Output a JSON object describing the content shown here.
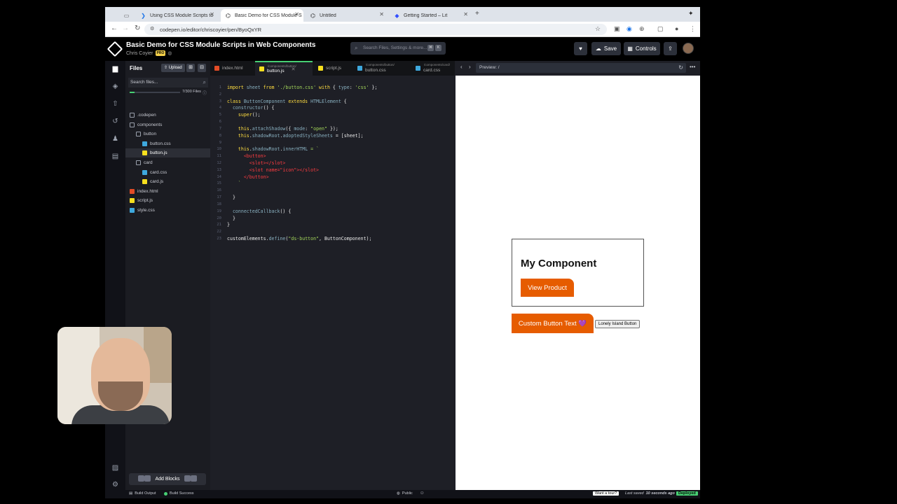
{
  "browser": {
    "tabs": [
      {
        "title": "Using CSS Module Scripts to",
        "active": false
      },
      {
        "title": "Basic Demo for CSS Module S",
        "active": true
      },
      {
        "title": "Untitled",
        "active": false
      },
      {
        "title": "Getting Started – Lit",
        "active": false
      }
    ],
    "new_tab": "+",
    "url": "codepen.io/editor/chriscoyier/pen/ByoQxYR"
  },
  "header": {
    "title": "Basic Demo for CSS Module Scripts in Web Components",
    "author": "Chris Coyier",
    "pro_badge": "PRO",
    "search_placeholder": "Search Files, Settings & more...",
    "kbd1": "⌘",
    "kbd2": "K",
    "save_label": "Save",
    "controls_label": "Controls"
  },
  "files_panel": {
    "title": "Files",
    "upload_label": "Upload",
    "search_placeholder": "Search files...",
    "quota_text": "7/300 Files",
    "quota_fraction": 0.023,
    "tree": [
      {
        "label": ".codepen",
        "icon": "folder-icon",
        "indent": 0,
        "color": "#9aa0ac"
      },
      {
        "label": "components",
        "icon": "folder-icon",
        "indent": 0,
        "color": "#9aa0ac"
      },
      {
        "label": "button",
        "icon": "folder-icon",
        "indent": 1,
        "color": "#9aa0ac"
      },
      {
        "label": "button.css",
        "icon": "css-file-icon",
        "indent": 2,
        "color": "#3ea8dd"
      },
      {
        "label": "button.js",
        "icon": "js-file-icon",
        "indent": 2,
        "color": "#f7df1e",
        "selected": true
      },
      {
        "label": "card",
        "icon": "folder-icon",
        "indent": 1,
        "color": "#9aa0ac"
      },
      {
        "label": "card.css",
        "icon": "css-file-icon",
        "indent": 2,
        "color": "#3ea8dd"
      },
      {
        "label": "card.js",
        "icon": "js-file-icon",
        "indent": 2,
        "color": "#f7df1e"
      },
      {
        "label": "index.html",
        "icon": "html-file-icon",
        "indent": 0,
        "color": "#e34c26"
      },
      {
        "label": "script.js",
        "icon": "js-file-icon",
        "indent": 0,
        "color": "#f7df1e"
      },
      {
        "label": "style.css",
        "icon": "css-file-icon",
        "indent": 0,
        "color": "#3ea8dd"
      }
    ],
    "add_blocks_label": "Add Blocks"
  },
  "editor_tabs": [
    {
      "label": "index.html",
      "sub": "",
      "color": "#e34c26",
      "active": false
    },
    {
      "label": "button.js",
      "sub": "/components/button/",
      "color": "#f7df1e",
      "active": true
    },
    {
      "label": "script.js",
      "sub": "",
      "color": "#f7df1e",
      "active": false
    },
    {
      "label": "button.css",
      "sub": "/components/button/",
      "color": "#3ea8dd",
      "active": false
    },
    {
      "label": "card.css",
      "sub": "/components/card/",
      "color": "#3ea8dd",
      "active": false
    }
  ],
  "code_lines": [
    [
      {
        "t": "import ",
        "c": "#ffdd40"
      },
      {
        "t": "sheet ",
        "c": "#88afbf"
      },
      {
        "t": "from ",
        "c": "#ffdd40"
      },
      {
        "t": "'./button.css' ",
        "c": "#a3d65a"
      },
      {
        "t": "with ",
        "c": "#ffdd40"
      },
      {
        "t": "{ ",
        "c": "#e8e8e8"
      },
      {
        "t": "type",
        "c": "#88afbf"
      },
      {
        "t": ": ",
        "c": "#e8e8e8"
      },
      {
        "t": "'css'",
        "c": "#a3d65a"
      },
      {
        "t": " };",
        "c": "#e8e8e8"
      }
    ],
    [],
    [
      {
        "t": "class ",
        "c": "#ffdd40"
      },
      {
        "t": "ButtonComponent ",
        "c": "#88afbf"
      },
      {
        "t": "extends ",
        "c": "#ffdd40"
      },
      {
        "t": "HTMLElement ",
        "c": "#88afbf"
      },
      {
        "t": "{",
        "c": "#e8e8e8"
      }
    ],
    [
      {
        "t": "  constructor",
        "c": "#88afbf"
      },
      {
        "t": "() {",
        "c": "#e8e8e8"
      }
    ],
    [
      {
        "t": "    super",
        "c": "#ffdd40"
      },
      {
        "t": "();",
        "c": "#e8e8e8"
      }
    ],
    [],
    [
      {
        "t": "    this",
        "c": "#ffdd40"
      },
      {
        "t": ".",
        "c": "#e8e8e8"
      },
      {
        "t": "attachShadow",
        "c": "#88afbf"
      },
      {
        "t": "({ ",
        "c": "#e8e8e8"
      },
      {
        "t": "mode",
        "c": "#88afbf"
      },
      {
        "t": ": ",
        "c": "#e8e8e8"
      },
      {
        "t": "\"open\"",
        "c": "#a3d65a"
      },
      {
        "t": " });",
        "c": "#e8e8e8"
      }
    ],
    [
      {
        "t": "    this",
        "c": "#ffdd40"
      },
      {
        "t": ".",
        "c": "#e8e8e8"
      },
      {
        "t": "shadowRoot",
        "c": "#88afbf"
      },
      {
        "t": ".",
        "c": "#e8e8e8"
      },
      {
        "t": "adoptedStyleSheets ",
        "c": "#88afbf"
      },
      {
        "t": "= [sheet];",
        "c": "#e8e8e8"
      }
    ],
    [],
    [
      {
        "t": "    this",
        "c": "#ffdd40"
      },
      {
        "t": ".",
        "c": "#e8e8e8"
      },
      {
        "t": "shadowRoot",
        "c": "#88afbf"
      },
      {
        "t": ".",
        "c": "#e8e8e8"
      },
      {
        "t": "innerHTML ",
        "c": "#88afbf"
      },
      {
        "t": "= `",
        "c": "#a3d65a"
      }
    ],
    [
      {
        "t": "      <button>",
        "c": "#ff3c41"
      }
    ],
    [
      {
        "t": "        <slot></slot>",
        "c": "#ff3c41"
      }
    ],
    [
      {
        "t": "        <slot name=\"icon\"></slot>",
        "c": "#ff3c41"
      }
    ],
    [
      {
        "t": "      </button>",
        "c": "#ff3c41"
      }
    ],
    [
      {
        "t": "    `",
        "c": "#a3d65a"
      }
    ],
    [],
    [
      {
        "t": "  }",
        "c": "#e8e8e8"
      }
    ],
    [],
    [
      {
        "t": "  connectedCallback",
        "c": "#88afbf"
      },
      {
        "t": "() {",
        "c": "#e8e8e8"
      }
    ],
    [
      {
        "t": "  }",
        "c": "#e8e8e8"
      }
    ],
    [
      {
        "t": "}",
        "c": "#e8e8e8"
      }
    ],
    [],
    [
      {
        "t": "customElements",
        "c": "#e8e8e8"
      },
      {
        "t": ".",
        "c": "#e8e8e8"
      },
      {
        "t": "define",
        "c": "#88afbf"
      },
      {
        "t": "(",
        "c": "#e8e8e8"
      },
      {
        "t": "\"ds-button\"",
        "c": "#a3d65a"
      },
      {
        "t": ", ButtonComponent);",
        "c": "#e8e8e8"
      }
    ]
  ],
  "current_line": 22,
  "preview": {
    "url_label": "Preview: /",
    "card_title": "My Component",
    "card_button": "View Product",
    "custom_button": "Custom Button Text 💜",
    "lonely_button": "Lonely Island Button"
  },
  "status": {
    "build_output": "Build Output",
    "build_success": "Build Success",
    "visibility": "Public",
    "tour_button": "Want a tour?",
    "last_saved_prefix": "Last saved",
    "last_saved_time": "10 seconds ago",
    "deployed": "Deployed"
  },
  "colors": {
    "accent_green": "#47cf73",
    "button_orange": "#e65c00"
  }
}
